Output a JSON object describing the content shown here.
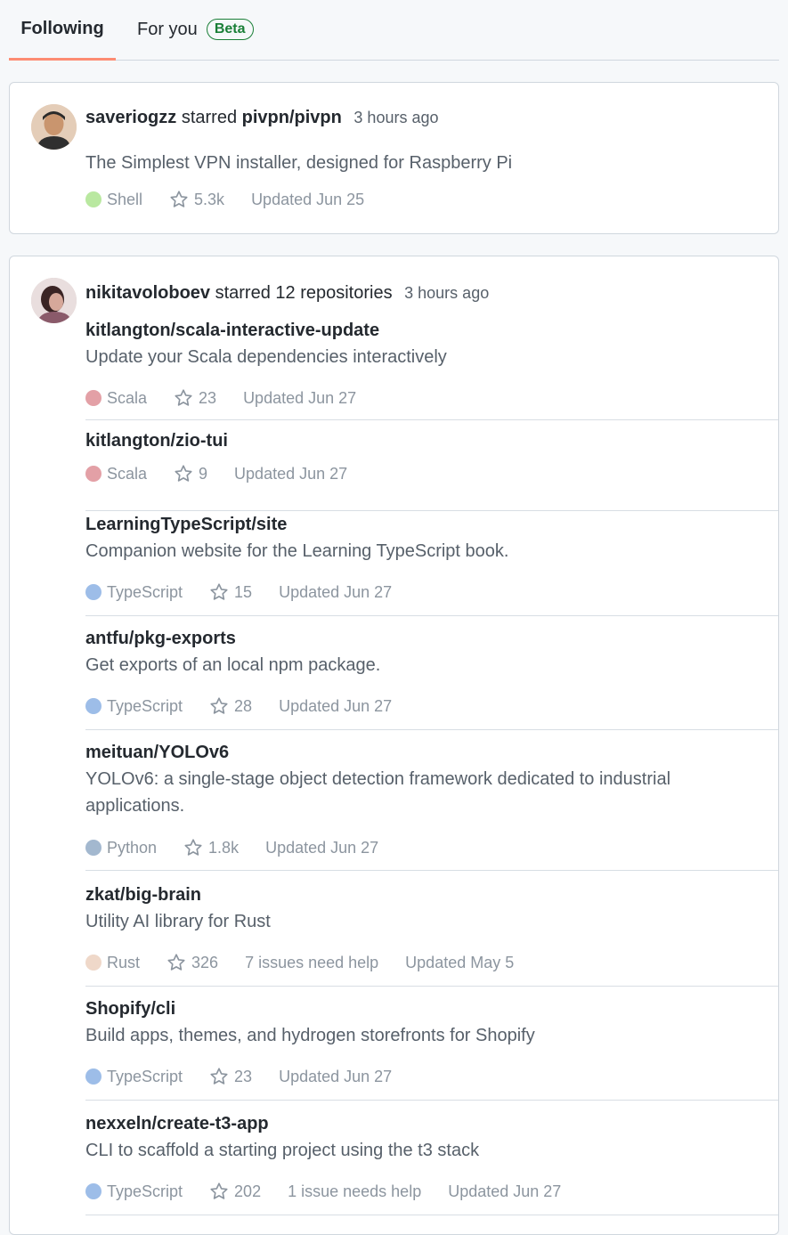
{
  "tabs": {
    "following": "Following",
    "for_you": "For you",
    "beta_badge": "Beta"
  },
  "card1": {
    "user": "saveriogzz",
    "action": "starred",
    "repo": "pivpn/pivpn",
    "time": "3 hours ago",
    "description": "The Simplest VPN installer, designed for Raspberry Pi",
    "language": "Shell",
    "language_color": "#b9e8a0",
    "stars": "5.3k",
    "updated": "Updated Jun 25"
  },
  "card2": {
    "user": "nikitavoloboev",
    "action": "starred 12 repositories",
    "time": "3 hours ago",
    "repos": [
      {
        "name": "kitlangton/scala-interactive-update",
        "description": "Update your Scala dependencies interactively",
        "language": "Scala",
        "language_color": "#e3a0a6",
        "stars": "23",
        "issues": "",
        "updated": "Updated Jun 27"
      },
      {
        "name": "kitlangton/zio-tui",
        "description": "",
        "language": "Scala",
        "language_color": "#e3a0a6",
        "stars": "9",
        "issues": "",
        "updated": "Updated Jun 27"
      },
      {
        "name": "LearningTypeScript/site",
        "description": "Companion website for the Learning TypeScript book.",
        "language": "TypeScript",
        "language_color": "#9dbde8",
        "stars": "15",
        "issues": "",
        "updated": "Updated Jun 27"
      },
      {
        "name": "antfu/pkg-exports",
        "description": "Get exports of an local npm package.",
        "language": "TypeScript",
        "language_color": "#9dbde8",
        "stars": "28",
        "issues": "",
        "updated": "Updated Jun 27"
      },
      {
        "name": "meituan/YOLOv6",
        "description": "YOLOv6: a single-stage object detection framework dedicated to industrial applications.",
        "language": "Python",
        "language_color": "#a3b8cf",
        "stars": "1.8k",
        "issues": "",
        "updated": "Updated Jun 27"
      },
      {
        "name": "zkat/big-brain",
        "description": "Utility AI library for Rust",
        "language": "Rust",
        "language_color": "#efd8c9",
        "stars": "326",
        "issues": "7 issues need help",
        "updated": "Updated May 5"
      },
      {
        "name": "Shopify/cli",
        "description": "Build apps, themes, and hydrogen storefronts for Shopify",
        "language": "TypeScript",
        "language_color": "#9dbde8",
        "stars": "23",
        "issues": "",
        "updated": "Updated Jun 27"
      },
      {
        "name": "nexxeln/create-t3-app",
        "description": "CLI to scaffold a starting project using the t3 stack",
        "language": "TypeScript",
        "language_color": "#9dbde8",
        "stars": "202",
        "issues": "1 issue needs help",
        "updated": "Updated Jun 27"
      }
    ]
  }
}
